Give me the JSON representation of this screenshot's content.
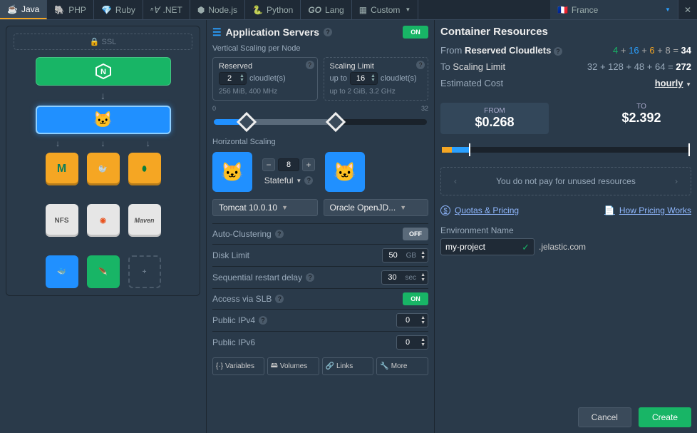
{
  "tabs": {
    "lang": [
      {
        "label": "Java"
      },
      {
        "label": "PHP"
      },
      {
        "label": "Ruby"
      },
      {
        "label": ".NET"
      },
      {
        "label": "Node.js"
      },
      {
        "label": "Python"
      },
      {
        "label": "Lang"
      },
      {
        "label": "Custom"
      }
    ],
    "region": "France"
  },
  "topo": {
    "ssl": "SSL",
    "tiles": {
      "nfs": "NFS"
    }
  },
  "mid": {
    "title": "Application Servers",
    "on_label": "ON",
    "vertical_label": "Vertical Scaling per Node",
    "reserved": {
      "title": "Reserved",
      "value": "2",
      "unit": "cloudlet(s)",
      "sub": "256 MiB, 400 MHz"
    },
    "limit": {
      "title": "Scaling Limit",
      "pre": "up to",
      "value": "16",
      "unit": "cloudlet(s)",
      "sub": "up to 2 GiB, 3.2 GHz"
    },
    "slider_min": "0",
    "slider_max": "32",
    "horiz_label": "Horizontal Scaling",
    "count": "8",
    "mode": "Stateful",
    "dd1": "Tomcat 10.0.10",
    "dd2": "Oracle OpenJD...",
    "rows": {
      "autocluster": {
        "k": "Auto-Clustering",
        "state": "OFF"
      },
      "disk": {
        "k": "Disk Limit",
        "v": "50",
        "u": "GB"
      },
      "restart": {
        "k": "Sequential restart delay",
        "v": "30",
        "u": "sec"
      },
      "slb": {
        "k": "Access via SLB",
        "state": "ON"
      },
      "ipv4": {
        "k": "Public IPv4",
        "v": "0"
      },
      "ipv6": {
        "k": "Public IPv6",
        "v": "0"
      }
    },
    "foot": {
      "vars": "Variables",
      "vols": "Volumes",
      "links": "Links",
      "more": "More"
    }
  },
  "right": {
    "title": "Container Resources",
    "from_label": "From",
    "from_word": "Reserved Cloudlets",
    "from_eq": {
      "a": "4",
      "b": "16",
      "c": "6",
      "d": "8",
      "sum": "34"
    },
    "to_label": "To",
    "to_word": "Scaling Limit",
    "to_eq": {
      "a": "32",
      "b": "128",
      "c": "48",
      "d": "64",
      "sum": "272"
    },
    "est_label": "Estimated Cost",
    "period": "hourly",
    "from_cap": "FROM",
    "from_amt": "$0.268",
    "to_cap": "TO",
    "to_amt": "$2.392",
    "notice": "You do not pay for unused resources",
    "quotas": "Quotas & Pricing",
    "howprice": "How Pricing Works",
    "env_label": "Environment Name",
    "env_value": "my-project",
    "domain": ".jelastic.com",
    "cancel": "Cancel",
    "create": "Create"
  }
}
